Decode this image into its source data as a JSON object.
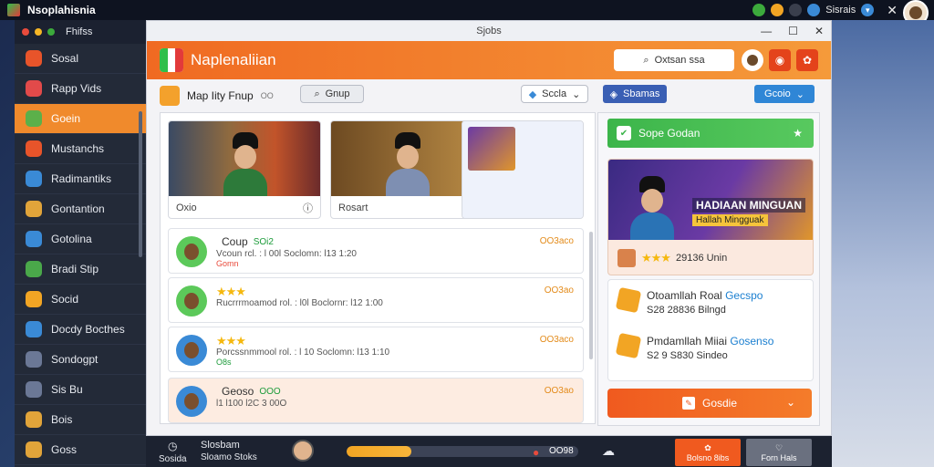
{
  "system": {
    "app_name": "Nsoplahisnia",
    "right_text": "Sisrais"
  },
  "dock": {
    "title": "Fhifss",
    "items": [
      {
        "label": "Sosal",
        "icon": "book-icon",
        "color": "#e8542a"
      },
      {
        "label": "Rapp Vids",
        "icon": "map-icon",
        "color": "#e24a4a"
      },
      {
        "label": "Goein",
        "icon": "globe-icon",
        "color": "#5bb04a"
      },
      {
        "label": "Mustanchs",
        "icon": "grid-icon",
        "color": "#e8542a"
      },
      {
        "label": "Radimantiks",
        "icon": "camera-icon",
        "color": "#3a8ad6"
      },
      {
        "label": "Gontantion",
        "icon": "badge-icon",
        "color": "#e1a43a"
      },
      {
        "label": "Gotolina",
        "icon": "globe-icon",
        "color": "#3a8ad6"
      },
      {
        "label": "Bradi Stip",
        "icon": "earth-icon",
        "color": "#4aa84a"
      },
      {
        "label": "Socid",
        "icon": "star-icon",
        "color": "#f2a524"
      },
      {
        "label": "Docdy Bocthes",
        "icon": "feather-icon",
        "color": "#3a8ad6"
      },
      {
        "label": "Sondogpt",
        "icon": "screen-icon",
        "color": "#6b7896"
      },
      {
        "label": "Sis Bu",
        "icon": "monitor-icon",
        "color": "#6b7896"
      },
      {
        "label": "Bois",
        "icon": "coin-icon",
        "color": "#e1a43a"
      },
      {
        "label": "Goss",
        "icon": "coin-icon",
        "color": "#e1a43a"
      }
    ],
    "active_index": 2
  },
  "window": {
    "title": "Sjobs",
    "brand": "Naplenaliian",
    "search_label": "Oxtsan ssa",
    "toolbar_title": "Map Iity Fnup",
    "toolbar_count": "OO",
    "group_label": "Gnup",
    "select_label": "Sccla"
  },
  "cards": [
    {
      "caption": "Oxio",
      "variant": "thumb-1"
    },
    {
      "caption": "Rosart",
      "variant": "thumb-2"
    },
    {
      "caption": "",
      "variant": "thumb-3"
    }
  ],
  "rows": [
    {
      "name": "Coup",
      "tag": "SOi2",
      "meta": "Vcoun rcl. : l 00l Soclomn: l13 1:20",
      "sub": "Gomn",
      "right": "OO3aco",
      "stars": "",
      "highlight": false,
      "avatar_color": "#5cc95a"
    },
    {
      "name": "",
      "tag": "",
      "meta": "Rucrrrmoamod rol. : l0l Boclornr: l12 1:00",
      "sub": "",
      "right": "OO3ao",
      "stars": "★★★",
      "highlight": false,
      "avatar_color": "#5cc95a"
    },
    {
      "name": "",
      "tag": "",
      "meta": "Porcssnmmool rol. : l 10 Soclomn: l13 1:10",
      "sub": "O8s",
      "right": "OO3aco",
      "stars": "★★★",
      "highlight": false,
      "avatar_color": "#3a8ad6"
    },
    {
      "name": "Geoso",
      "tag": "OOO",
      "meta": "l1 l100 l2C 3 00O",
      "sub": "",
      "right": "OO3ao",
      "stars": "",
      "highlight": true,
      "avatar_color": "#3a8ad6"
    }
  ],
  "right": {
    "tab1": "Sbamas",
    "tab2": "Gcoio",
    "green_bar": "Sope Godan",
    "promo_title": "HADIAAN MINGUAN",
    "promo_sub": "Hallah Mingguak",
    "promo_stars": "★★★",
    "promo_foot": "29136 Unin",
    "info": [
      {
        "title": "Otoamllah Roal",
        "link": "Gecspo",
        "sub": "S28 28836 Bilngd"
      },
      {
        "title": "Pmdamllah Miiai",
        "link": "Gosenso",
        "sub": "S2 9 S830 Sindeo"
      }
    ],
    "action_label": "Gosdie"
  },
  "taskbar": {
    "item1_top": "",
    "item1_bottom": "Sosida",
    "item2_top": "Slosbam",
    "item2_bottom": "Sloamo Stoks",
    "progress": 0.28,
    "progress_label": "OO98",
    "btn1": "Bolsno 8ibs",
    "btn2": "Forn Hals"
  }
}
